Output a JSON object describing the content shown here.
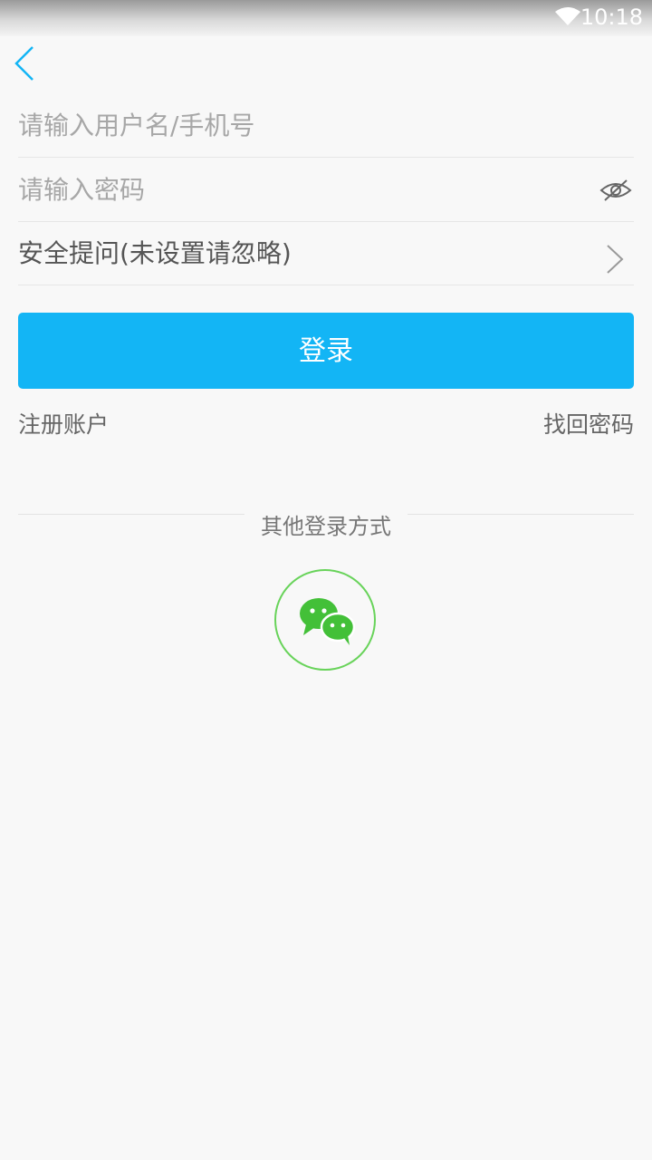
{
  "status_bar": {
    "time": "10:18"
  },
  "form": {
    "username_placeholder": "请输入用户名/手机号",
    "password_placeholder": "请输入密码",
    "security_question_label": "安全提问(未设置请忽略)"
  },
  "actions": {
    "login_label": "登录",
    "register_label": "注册账户",
    "forgot_password_label": "找回密码"
  },
  "other_login": {
    "title": "其他登录方式",
    "methods": [
      "wechat-icon"
    ]
  },
  "colors": {
    "accent": "#13b5f5",
    "wechat_green": "#68d35a",
    "background": "#f8f8f8"
  }
}
